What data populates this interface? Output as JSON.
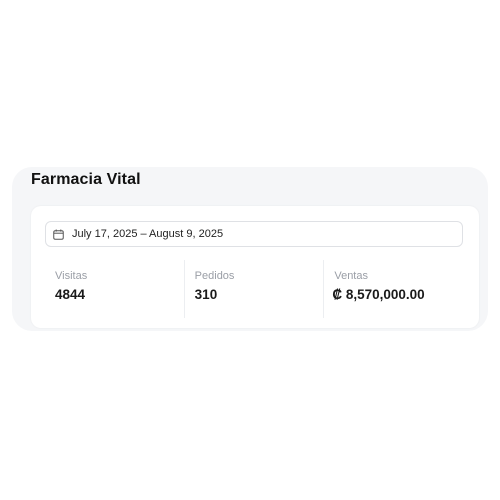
{
  "store": {
    "title": "Farmacia Vital"
  },
  "date_range": {
    "icon": "calendar-icon",
    "label": "July 17, 2025 – August 9, 2025"
  },
  "stats": [
    {
      "label": "Visitas",
      "value": "4844"
    },
    {
      "label": "Pedidos",
      "value": "310"
    },
    {
      "label": "Ventas",
      "value": "₡ 8,570,000.00"
    }
  ]
}
